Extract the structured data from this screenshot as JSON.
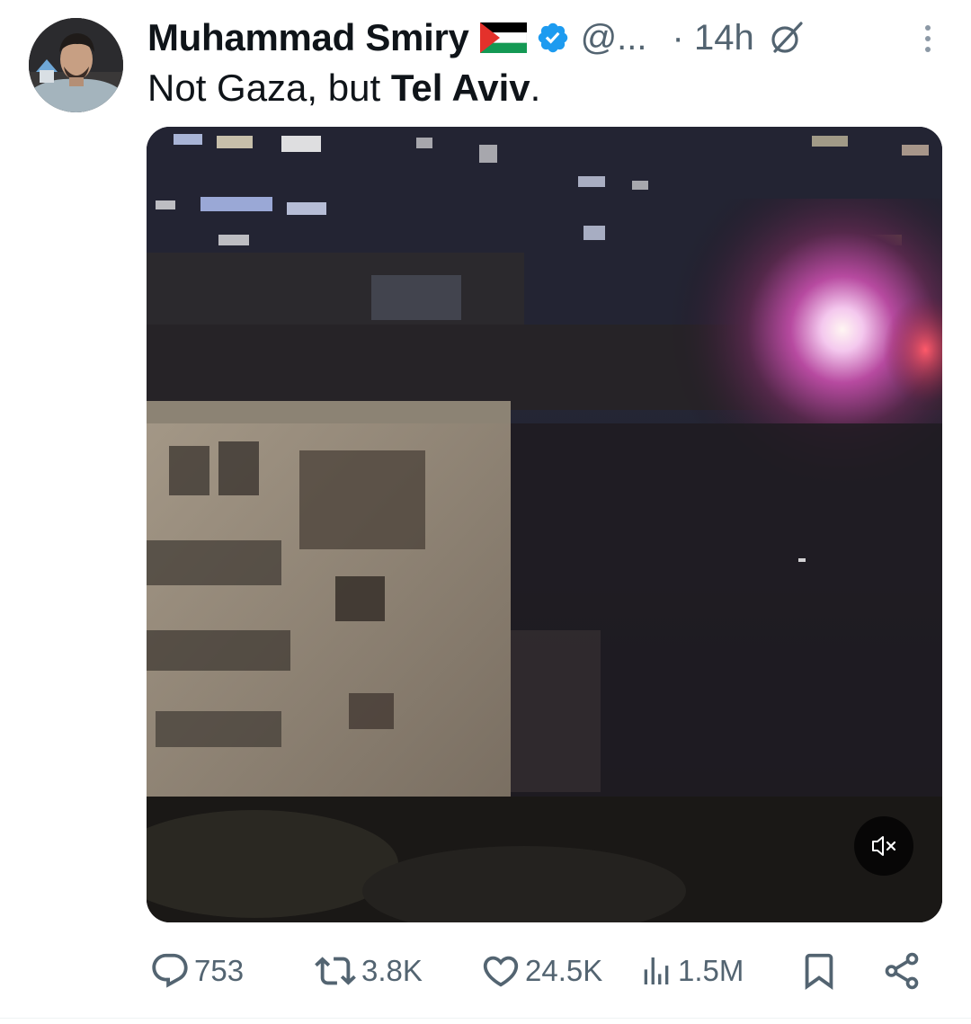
{
  "author": {
    "name": "Muhammad Smiry",
    "flag_icon": "palestine-flag-icon",
    "verified_icon": "verified-badge-icon",
    "handle": "@...",
    "time": "· 14h",
    "grok_icon": "grok-icon",
    "more_icon": "more-vertical-icon"
  },
  "tweet": {
    "text_part1": "Not Gaza, but ",
    "text_bold": "Tel Aviv",
    "text_part2": "."
  },
  "media": {
    "type": "video",
    "mute_icon": "volume-muted-icon"
  },
  "actions": {
    "replies": "753",
    "reposts": "3.8K",
    "likes": "24.5K",
    "views": "1.5M",
    "reply_icon": "reply-icon",
    "repost_icon": "repost-icon",
    "like_icon": "heart-icon",
    "views_icon": "views-chart-icon",
    "bookmark_icon": "bookmark-icon",
    "share_icon": "share-icon"
  },
  "colors": {
    "text": "#0f1419",
    "secondary": "#536471",
    "verified": "#1d9bf0"
  }
}
